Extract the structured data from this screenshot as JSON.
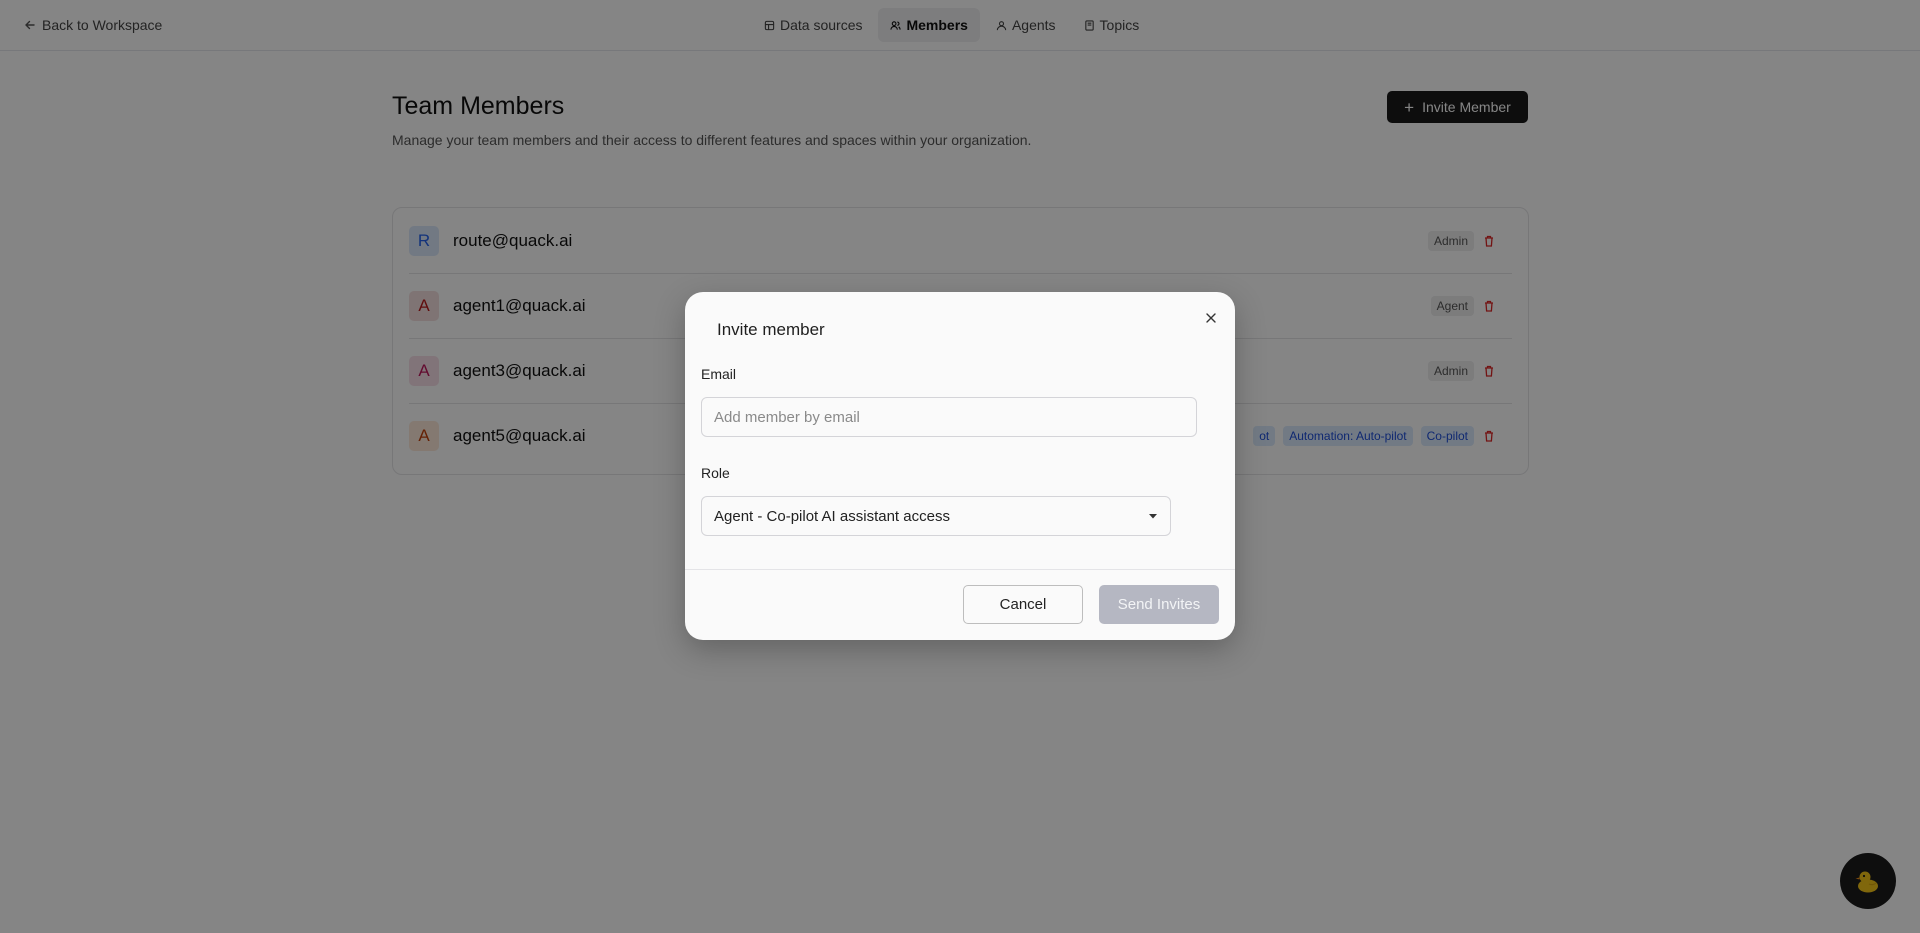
{
  "nav": {
    "back_label": "Back to Workspace",
    "tabs": [
      {
        "label": "Data sources",
        "icon": "database-icon",
        "active": false
      },
      {
        "label": "Members",
        "icon": "users-icon",
        "active": true
      },
      {
        "label": "Agents",
        "icon": "agent-icon",
        "active": false
      },
      {
        "label": "Topics",
        "icon": "book-icon",
        "active": false
      }
    ]
  },
  "main": {
    "title": "Team Members",
    "subtitle": "Manage your team members and their access to different features and spaces within your organization.",
    "invite_button_label": "Invite Member"
  },
  "members": [
    {
      "initial": "R",
      "email": "route@quack.ai",
      "avatar_bg": "#dbe8fb",
      "avatar_fg": "#2563eb",
      "badges": [
        "Admin"
      ]
    },
    {
      "initial": "A",
      "email": "agent1@quack.ai",
      "avatar_bg": "#f4dede",
      "avatar_fg": "#b91c1c",
      "badges": [
        "Agent"
      ]
    },
    {
      "initial": "A",
      "email": "agent3@quack.ai",
      "avatar_bg": "#f8dfe8",
      "avatar_fg": "#be185d",
      "badges": [
        "Admin"
      ]
    },
    {
      "initial": "A",
      "email": "agent5@quack.ai",
      "avatar_bg": "#fde8d8",
      "avatar_fg": "#c2410c",
      "badges": [
        "ot",
        "Automation: Auto-pilot",
        "Co-pilot"
      ]
    }
  ],
  "dialog": {
    "title": "Invite member",
    "email_label": "Email",
    "email_placeholder": "Add member by email",
    "email_value": "",
    "role_label": "Role",
    "role_value": "Agent - Co-pilot AI assistant access",
    "cancel_label": "Cancel",
    "send_label": "Send Invites"
  },
  "colors": {
    "primary_button": "#1a1a1a",
    "disabled_button": "#b5b7c2",
    "delete_icon": "#dc2626",
    "badge_blue_bg": "#dbeafe",
    "badge_blue_fg": "#1d4ed8"
  },
  "floating": {
    "icon": "duck-icon"
  }
}
